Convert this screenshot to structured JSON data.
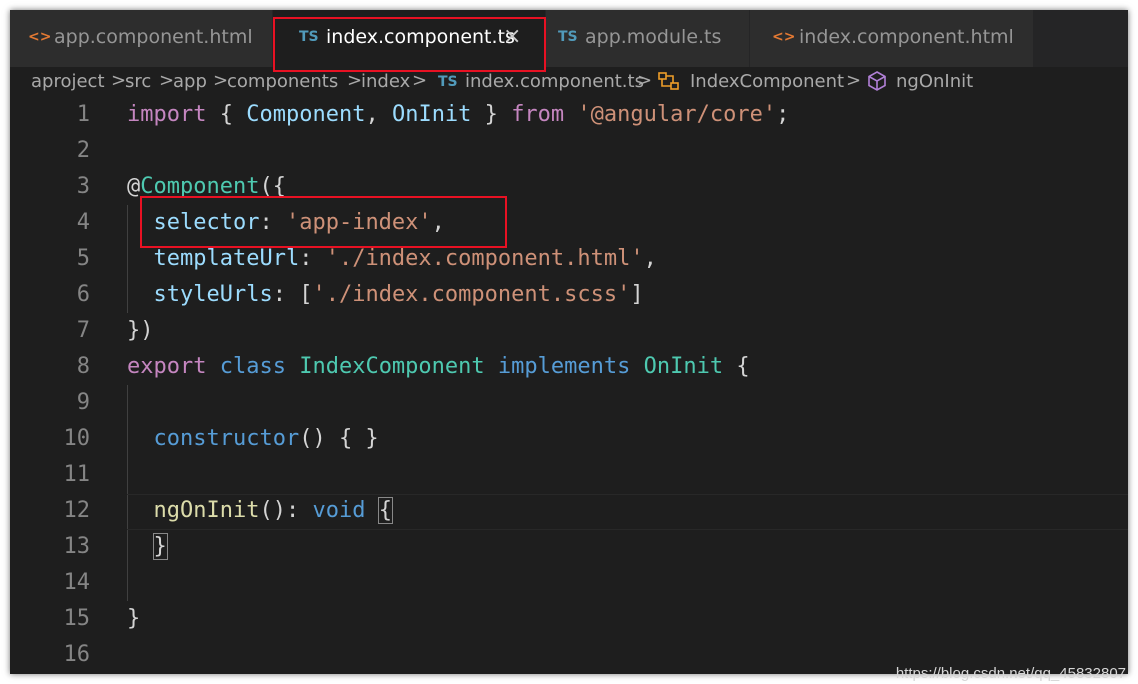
{
  "tabs": [
    {
      "icon": "<>",
      "icon_name": "html-file-icon",
      "label": "app.component.html",
      "active": false
    },
    {
      "icon": "TS",
      "icon_name": "typescript-file-icon",
      "label": "index.component.ts",
      "active": true,
      "close": "×"
    },
    {
      "icon": "TS",
      "icon_name": "typescript-file-icon",
      "label": "app.module.ts",
      "active": false
    },
    {
      "icon": "<>",
      "icon_name": "html-file-icon",
      "label": "index.component.html",
      "active": false
    }
  ],
  "breadcrumb": {
    "items": [
      "aproject",
      "src",
      "app",
      "components",
      "index",
      "index.component.ts",
      "IndexComponent",
      "ngOnInit"
    ],
    "file_icon": "TS",
    "separator": ">"
  },
  "editor": {
    "line_numbers": [
      "1",
      "2",
      "3",
      "4",
      "5",
      "6",
      "7",
      "8",
      "9",
      "10",
      "11",
      "12",
      "13",
      "14",
      "15",
      "16"
    ],
    "lines": {
      "l1": {
        "import": "import",
        "b1": " { ",
        "component": "Component",
        "comma": ", ",
        "oninit": "OnInit",
        "b2": " } ",
        "from": "from",
        "sp": " ",
        "module": "'@angular/core'",
        "semi": ";"
      },
      "l3": {
        "at": "@",
        "component": "Component",
        "open": "({"
      },
      "l4": {
        "indent": "  ",
        "key": "selector",
        "colon": ": ",
        "value": "'app-index'",
        "comma": ","
      },
      "l5": {
        "indent": "  ",
        "key": "templateUrl",
        "colon": ": ",
        "value": "'./index.component.html'",
        "comma": ","
      },
      "l6": {
        "indent": "  ",
        "key": "styleUrls",
        "colon": ": [",
        "value": "'./index.component.scss'",
        "close": "]"
      },
      "l7": {
        "text": "})"
      },
      "l8": {
        "export": "export",
        "sp1": " ",
        "class": "class",
        "sp2": " ",
        "name": "IndexComponent",
        "sp3": " ",
        "implements": "implements",
        "sp4": " ",
        "iface": "OnInit",
        "brace": " {"
      },
      "l10": {
        "indent": "  ",
        "ctor": "constructor",
        "rest": "() { }"
      },
      "l12": {
        "indent": "  ",
        "method": "ngOnInit",
        "paren": "(): ",
        "void": "void",
        "sp": " ",
        "brace": "{"
      },
      "l13": {
        "indent": "  ",
        "brace": "}"
      },
      "l15": {
        "text": "}"
      }
    }
  },
  "watermark": "https://blog.csdn.net/qq_45832807",
  "colors": {
    "highlight_box": "#e81123",
    "background": "#1e1e1e"
  }
}
